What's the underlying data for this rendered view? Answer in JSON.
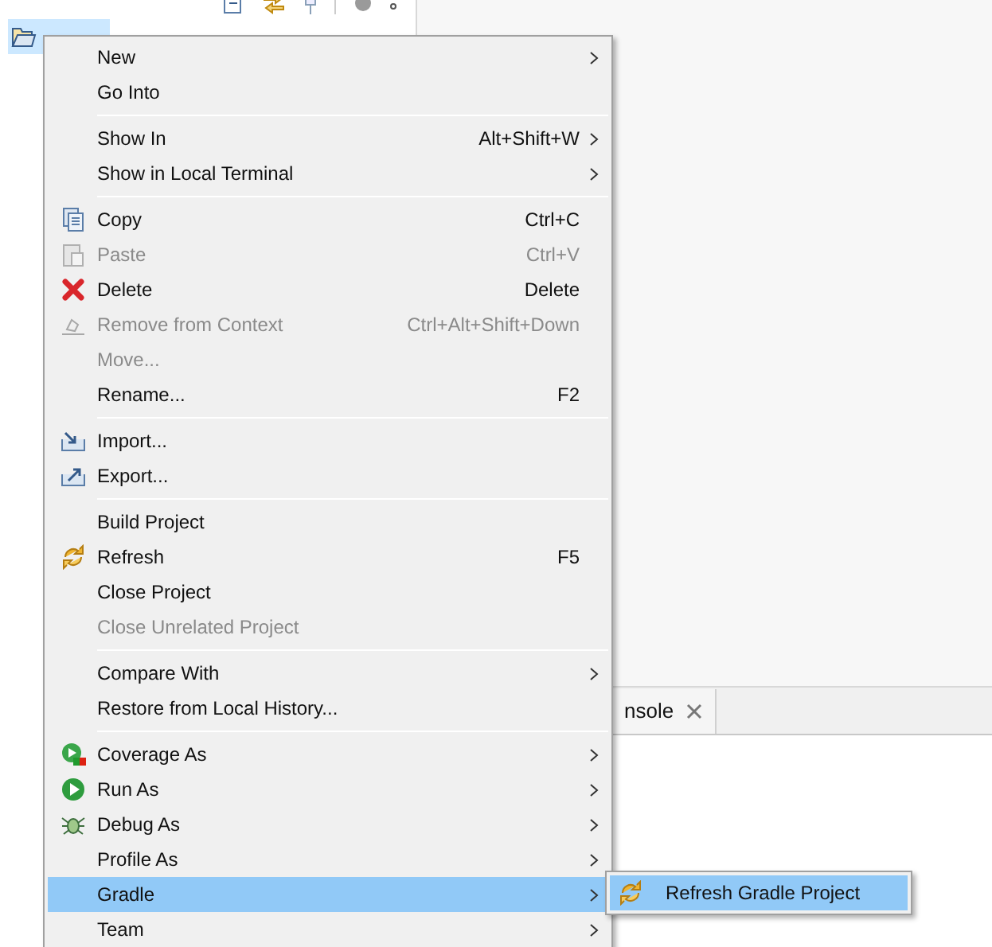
{
  "tree": {
    "item": {
      "selected": true
    }
  },
  "console_tab": {
    "label": "nsole"
  },
  "context_menu": {
    "sections": [
      [
        {
          "label": "New",
          "submenu": true,
          "disabled": false,
          "selected": false
        },
        {
          "label": "Go Into",
          "submenu": false,
          "disabled": false,
          "selected": false
        }
      ],
      [
        {
          "label": "Show In",
          "shortcut": "Alt+Shift+W",
          "submenu": true,
          "disabled": false,
          "selected": false
        },
        {
          "label": "Show in Local Terminal",
          "submenu": true,
          "disabled": false,
          "selected": false
        }
      ],
      [
        {
          "label": "Copy",
          "shortcut": "Ctrl+C",
          "kind": "copy",
          "submenu": false,
          "disabled": false,
          "selected": false
        },
        {
          "label": "Paste",
          "shortcut": "Ctrl+V",
          "kind": "paste",
          "submenu": false,
          "disabled": true,
          "selected": false
        },
        {
          "label": "Delete",
          "shortcut": "Delete",
          "kind": "delete",
          "submenu": false,
          "disabled": false,
          "selected": false
        },
        {
          "label": "Remove from Context",
          "shortcut": "Ctrl+Alt+Shift+Down",
          "kind": "remove",
          "submenu": false,
          "disabled": true,
          "selected": false
        },
        {
          "label": "Move...",
          "submenu": false,
          "disabled": true,
          "selected": false
        },
        {
          "label": "Rename...",
          "shortcut": "F2",
          "submenu": false,
          "disabled": false,
          "selected": false
        }
      ],
      [
        {
          "label": "Import...",
          "kind": "import",
          "submenu": false,
          "disabled": false,
          "selected": false
        },
        {
          "label": "Export...",
          "kind": "export",
          "submenu": false,
          "disabled": false,
          "selected": false
        }
      ],
      [
        {
          "label": "Build Project",
          "submenu": false,
          "disabled": false,
          "selected": false
        },
        {
          "label": "Refresh",
          "shortcut": "F5",
          "kind": "refresh",
          "submenu": false,
          "disabled": false,
          "selected": false
        },
        {
          "label": "Close Project",
          "submenu": false,
          "disabled": false,
          "selected": false
        },
        {
          "label": "Close Unrelated Project",
          "submenu": false,
          "disabled": true,
          "selected": false
        }
      ],
      [
        {
          "label": "Compare With",
          "submenu": true,
          "disabled": false,
          "selected": false
        },
        {
          "label": "Restore from Local History...",
          "submenu": false,
          "disabled": false,
          "selected": false
        }
      ],
      [
        {
          "label": "Coverage As",
          "kind": "coverage",
          "submenu": true,
          "disabled": false,
          "selected": false
        },
        {
          "label": "Run As",
          "kind": "run",
          "submenu": true,
          "disabled": false,
          "selected": false
        },
        {
          "label": "Debug As",
          "kind": "debug",
          "submenu": true,
          "disabled": false,
          "selected": false
        },
        {
          "label": "Profile As",
          "submenu": true,
          "disabled": false,
          "selected": false
        },
        {
          "label": "Gradle",
          "submenu": true,
          "disabled": false,
          "selected": true
        },
        {
          "label": "Team",
          "submenu": true,
          "disabled": false,
          "selected": false
        }
      ]
    ]
  },
  "submenu": {
    "items": [
      {
        "label": "Refresh Gradle Project",
        "kind": "refresh",
        "selected": true
      }
    ]
  }
}
